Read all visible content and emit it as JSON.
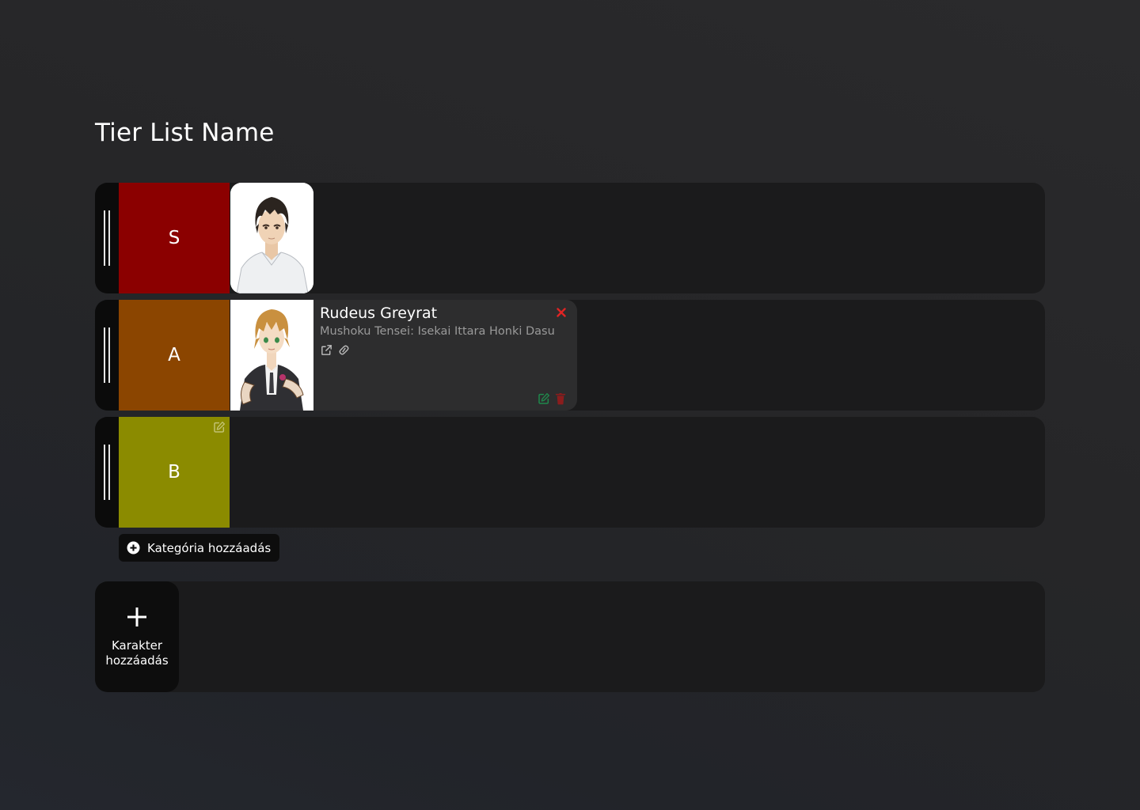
{
  "page": {
    "title": "Tier List Name"
  },
  "tiers": [
    {
      "label": "S",
      "color": "#8b0000"
    },
    {
      "label": "A",
      "color": "#8b4500"
    },
    {
      "label": "B",
      "color": "#8b8b00"
    }
  ],
  "characters": {
    "s_tier_0": {
      "name": "",
      "icon": "character-portrait"
    },
    "a_tier_0": {
      "name": "Rudeus Greyrat",
      "series": "Mushoku Tensei: Isekai Ittara Honki Dasu",
      "icons": [
        "external-link-icon",
        "link-icon",
        "close-icon",
        "edit-icon",
        "trash-icon"
      ]
    }
  },
  "buttons": {
    "add_category": "Kategória hozzáadás",
    "add_character_line1": "Karakter",
    "add_character_line2": "hozzáadás"
  },
  "colors": {
    "background": "#262628",
    "row_bg": "#1b1b1c",
    "handle_bg": "#0b0b0b",
    "card_bg": "#2d2d2e",
    "close_red": "#e02424",
    "edit_green": "#1f8a4c",
    "trash_red": "#8b1d1d"
  }
}
